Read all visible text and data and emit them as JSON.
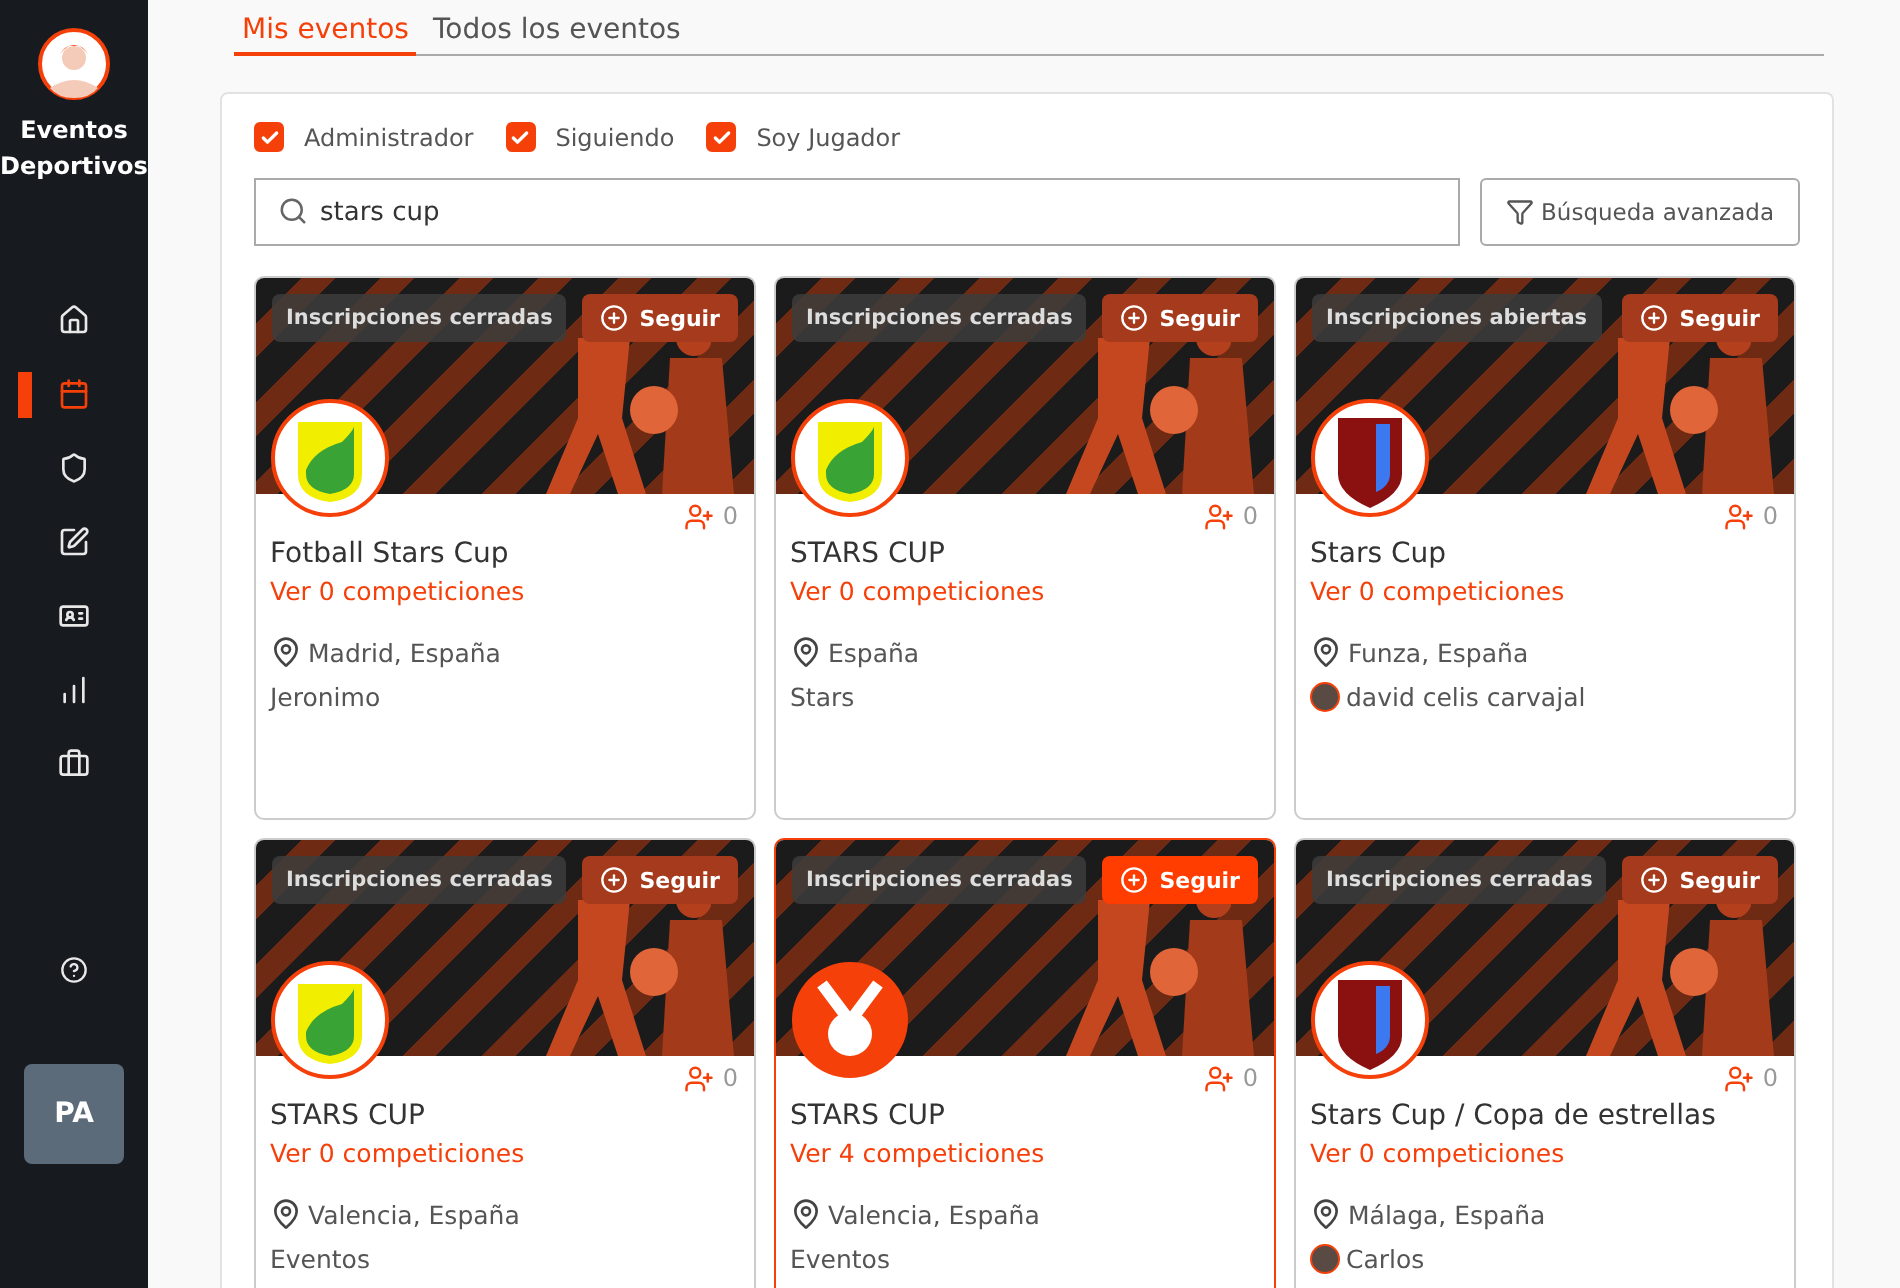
{
  "sidebar": {
    "app_name": "Eventos Deportivos",
    "nav": [
      {
        "kind": "home",
        "selected": false
      },
      {
        "kind": "calendar",
        "selected": true
      },
      {
        "kind": "shield",
        "selected": false
      },
      {
        "kind": "edit",
        "selected": false
      },
      {
        "kind": "id-card",
        "selected": false
      },
      {
        "kind": "bars",
        "selected": false
      },
      {
        "kind": "briefcase",
        "selected": false
      }
    ],
    "help": true,
    "user_initials": "PA"
  },
  "tabs": [
    {
      "label": "Mis eventos",
      "selected": true
    },
    {
      "label": "Todos los eventos",
      "selected": false
    }
  ],
  "filters": [
    {
      "label": "Administrador",
      "checked": true
    },
    {
      "label": "Siguiendo",
      "checked": true
    },
    {
      "label": "Soy Jugador",
      "checked": true
    }
  ],
  "search": {
    "value": "stars cup"
  },
  "advanced_search_button": "Búsqueda avanzada",
  "events": [
    {
      "status": "Inscripciones cerradas",
      "follow": "Seguir",
      "logo": {
        "kind": "yellow-green"
      },
      "followers": "0",
      "title": "Fotball Stars Cup",
      "competitions": "Ver 0 competiciones",
      "location": "Madrid, España",
      "organizer": "Jeronimo",
      "organizer_avatar": false,
      "highlighted": false
    },
    {
      "status": "Inscripciones cerradas",
      "follow": "Seguir",
      "logo": {
        "kind": "yellow-green"
      },
      "followers": "0",
      "title": "STARS CUP",
      "competitions": "Ver 0 competiciones",
      "location": "España",
      "organizer": "Stars",
      "organizer_avatar": false,
      "highlighted": false
    },
    {
      "status": "Inscripciones abiertas",
      "follow": "Seguir",
      "logo": {
        "kind": "red-blue"
      },
      "followers": "0",
      "title": "Stars Cup",
      "competitions": "Ver 0 competiciones",
      "location": "Funza, España",
      "organizer": "david celis carvajal",
      "organizer_avatar": true,
      "highlighted": false
    },
    {
      "status": "Inscripciones cerradas",
      "follow": "Seguir",
      "logo": {
        "kind": "yellow-green"
      },
      "followers": "0",
      "title": "STARS CUP",
      "competitions": "Ver 0 competiciones",
      "location": "Valencia, España",
      "organizer": "Eventos",
      "organizer_avatar": false,
      "highlighted": false
    },
    {
      "status": "Inscripciones cerradas",
      "follow": "Seguir",
      "logo": {
        "kind": "medal"
      },
      "followers": "0",
      "title": "STARS CUP",
      "competitions": "Ver 4 competiciones",
      "location": "Valencia, España",
      "organizer": "Eventos",
      "organizer_avatar": false,
      "highlighted": true
    },
    {
      "status": "Inscripciones cerradas",
      "follow": "Seguir",
      "logo": {
        "kind": "red-blue"
      },
      "followers": "0",
      "title": "Stars Cup / Copa de estrellas",
      "competitions": "Ver 0 competiciones",
      "location": "Málaga, España",
      "organizer": "Carlos",
      "organizer_avatar": true,
      "highlighted": false
    }
  ]
}
